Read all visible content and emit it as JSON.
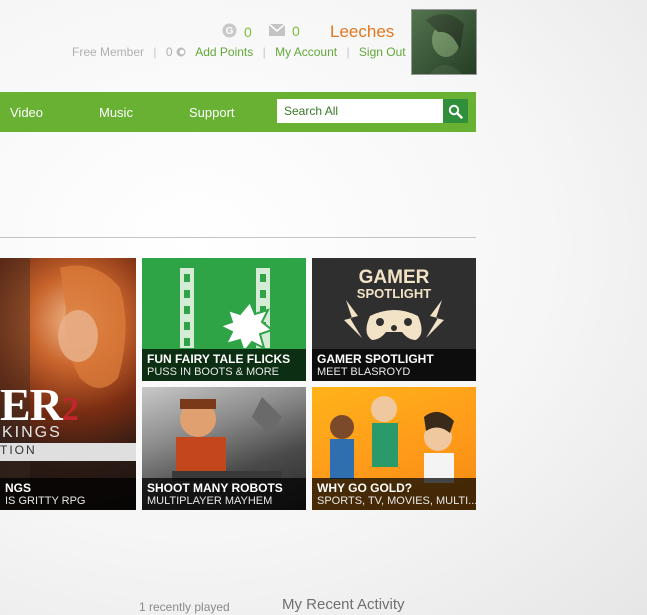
{
  "header": {
    "gamerscore_count": "0",
    "messages_count": "0",
    "user_name": "Leeches",
    "membership": "Free Member",
    "points": "0",
    "links": {
      "add_points": "Add Points",
      "my_account": "My Account",
      "sign_out": "Sign Out"
    }
  },
  "nav": {
    "items": [
      "Video",
      "Music",
      "Support"
    ],
    "search_placeholder": "Search All"
  },
  "tiles": [
    {
      "title": "",
      "subtitle": "",
      "partial_title": "NGS",
      "partial_subtitle": "IS GRITTY RPG",
      "art_text_top": "ER",
      "art_text_num": "2",
      "art_text_mid": "KINGS",
      "art_text_bot": "TION"
    },
    {
      "title": "FUN FAIRY TALE FLICKS",
      "subtitle": "PUSS IN BOOTS & MORE"
    },
    {
      "title": "GAMER SPOTLIGHT",
      "subtitle": "MEET BLASROYD",
      "art_line1": "GAMER",
      "art_line2": "SPOTLIGHT"
    },
    {
      "title": "SHOOT MANY ROBOTS",
      "subtitle": "MULTIPLAYER MAYHEM"
    },
    {
      "title": "WHY GO GOLD?",
      "subtitle": "SPORTS, TV, MOVIES, MULTI..."
    }
  ],
  "footer": {
    "recently_played": "1 recently played",
    "recent_activity": "My Recent Activity"
  },
  "colors": {
    "accent_green": "#68b133",
    "link_green": "#62a83a",
    "name_orange": "#e2781f",
    "search_button": "#2f8f3b"
  }
}
